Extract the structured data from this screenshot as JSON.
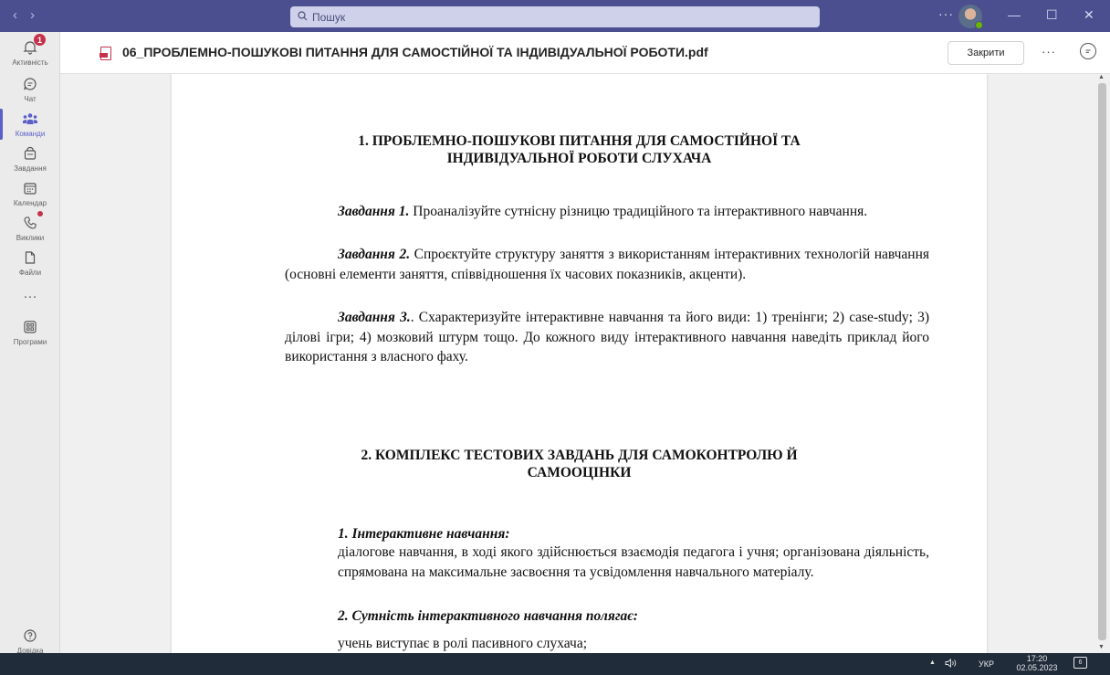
{
  "titlebar": {
    "search_placeholder": "Пошук",
    "back_glyph": "‹",
    "forward_glyph": "›",
    "more_glyph": "···",
    "minimize_glyph": "—",
    "maximize_glyph": "☐",
    "close_glyph": "✕"
  },
  "rail": {
    "items": [
      {
        "label": "Активність",
        "icon": "bell-icon",
        "badge": "1"
      },
      {
        "label": "Чат",
        "icon": "chat-icon"
      },
      {
        "label": "Команди",
        "icon": "teams-icon"
      },
      {
        "label": "Завдання",
        "icon": "assignments-icon"
      },
      {
        "label": "Календар",
        "icon": "calendar-icon"
      },
      {
        "label": "Виклики",
        "icon": "phone-icon"
      },
      {
        "label": "Файли",
        "icon": "file-icon"
      },
      {
        "label": "Програми",
        "icon": "apps-icon"
      },
      {
        "label": "Довідка",
        "icon": "help-icon"
      }
    ],
    "more_glyph": "···"
  },
  "header": {
    "title": "06_ПРОБЛЕМНО-ПОШУКОВІ ПИТАННЯ ДЛЯ САМОСТІЙНОЇ ТА ІНДИВІДУАЛЬНОЇ РОБОТИ.pdf",
    "close_label": "Закрити",
    "more_glyph": "···"
  },
  "document": {
    "section1_title_line1": "1. ПРОБЛЕМНО-ПОШУКОВІ ПИТАННЯ ДЛЯ САМОСТІЙНОЇ ТА",
    "section1_title_line2": "ІНДИВІДУАЛЬНОЇ РОБОТИ СЛУХАЧА",
    "task1_lead": "Завдання 1.",
    "task1_text": " Проаналізуйте сутнісну різницю традиційного та інтерактивного навчання.",
    "task2_lead": "Завдання 2.",
    "task2_text": " Спроєктуйте структуру заняття з використанням інтерактивних технологій навчання (основні елементи заняття, співвідношення їх часових показників, акценти).",
    "task3_lead": "Завдання 3.",
    "task3_text": ". Схарактеризуйте інтерактивне навчання та його види: 1) тренінги; 2) case-study; 3) ділові ігри; 4) мозковий штурм тощо. До кожного виду інтерактивного навчання наведіть приклад його використання з власного фаху.",
    "section2_title_line1": "2. КОМПЛЕКС ТЕСТОВИХ ЗАВДАНЬ ДЛЯ САМОКОНТРОЛЮ Й",
    "section2_title_line2": "САМООЦІНКИ",
    "q1_title": "1. Інтерактивне навчання:",
    "q1_text": "діалогове навчання, в ході якого здійснюється взаємодія педагога і учня; організована діяльність, спрямована на максимальне засвоєння та усвідомлення навчального матеріалу.",
    "q2_title": "2. Сутність інтерактивного навчання полягає:",
    "q2_text": "учень виступає в ролі пасивного слухача;"
  },
  "taskbar": {
    "language": "УКР",
    "time": "17:20",
    "date": "02.05.2023",
    "notifications": "6"
  },
  "colors": {
    "titlebar": "#4b4f8f",
    "accent": "#5b5fc7",
    "badge": "#c4314b",
    "taskbar": "#202c3a"
  }
}
